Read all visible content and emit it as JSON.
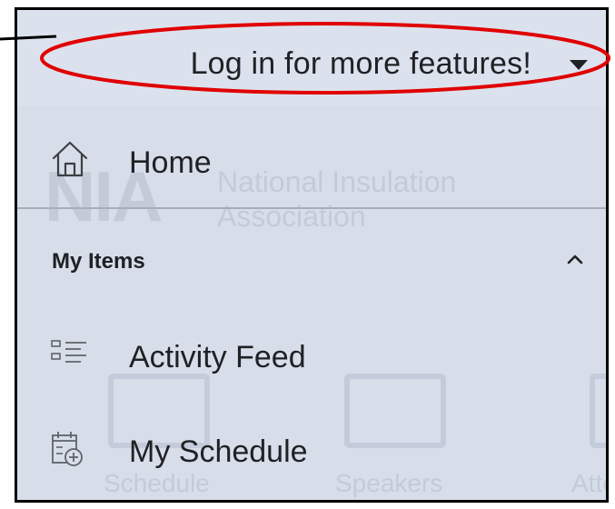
{
  "drawer": {
    "header": {
      "login_prompt": "Log in for more features!"
    },
    "home": {
      "label": "Home",
      "icon": "home-icon"
    },
    "section": {
      "label": "My Items",
      "icon": "chevron-up-icon"
    },
    "items": [
      {
        "label": "Activity Feed",
        "icon": "list-icon"
      },
      {
        "label": "My Schedule",
        "icon": "calendar-add-icon"
      }
    ]
  },
  "background": {
    "logo_text": "NIA",
    "org_name_line1": "National Insulation",
    "org_name_line2": "Association",
    "tiles": [
      "Schedule",
      "Speakers",
      "Attendees"
    ]
  },
  "annotation": {
    "color": "#e00000"
  },
  "colors": {
    "drawer_bg": "#d7deea",
    "text": "#202124",
    "divider": "#a7aeb8"
  }
}
